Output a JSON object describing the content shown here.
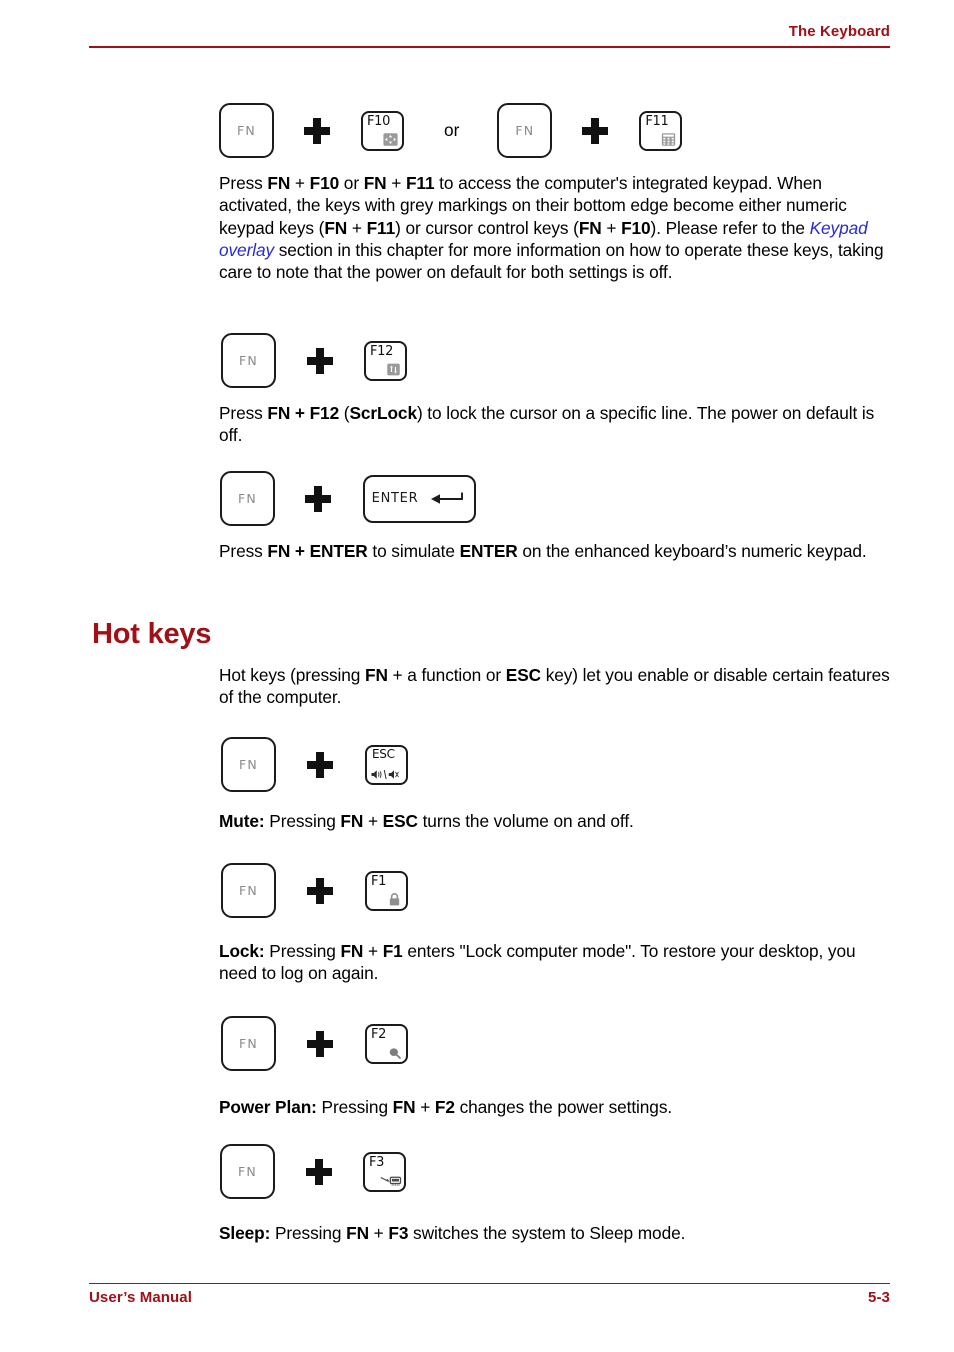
{
  "header": {
    "title": "The Keyboard"
  },
  "footer": {
    "manual_label": "User’s Manual",
    "page_number": "5-3"
  },
  "colors": {
    "accent_red": "#a11016",
    "link_blue": "#2a2ad0",
    "key_outline": "#1b1b1b",
    "fn_label_grey": "#8a8a8a"
  },
  "keys": {
    "fn_label": "FN",
    "enter_label": "ENTER",
    "or_label": "or",
    "f10_label": "F10",
    "f11_label": "F11",
    "f12_label": "F12",
    "esc_label": "ESC",
    "f1_label": "F1",
    "f2_label": "F2",
    "f3_label": "F3"
  },
  "sections": {
    "keypad": {
      "paragraph_parts": [
        {
          "t": "Press ",
          "s": "normal"
        },
        {
          "t": "FN",
          "s": "bold"
        },
        {
          "t": " + ",
          "s": "normal"
        },
        {
          "t": "F10",
          "s": "bold"
        },
        {
          "t": " or ",
          "s": "normal"
        },
        {
          "t": "FN",
          "s": "bold"
        },
        {
          "t": " + ",
          "s": "normal"
        },
        {
          "t": "F11",
          "s": "bold"
        },
        {
          "t": " to access the computer's integrated keypad. When activated, the keys with grey markings on their bottom edge become either numeric keypad keys (",
          "s": "normal"
        },
        {
          "t": "FN",
          "s": "bold"
        },
        {
          "t": " + ",
          "s": "normal"
        },
        {
          "t": "F11",
          "s": "bold"
        },
        {
          "t": ") or cursor control keys (",
          "s": "normal"
        },
        {
          "t": "FN",
          "s": "bold"
        },
        {
          "t": " + ",
          "s": "normal"
        },
        {
          "t": "F10",
          "s": "bold"
        },
        {
          "t": "). Please refer to the ",
          "s": "normal"
        },
        {
          "t": "Keypad overlay",
          "s": "link"
        },
        {
          "t": " section in this chapter for more information on how to operate these keys, taking care to note that the power on default for both settings is off.",
          "s": "normal"
        }
      ]
    },
    "scrlock": {
      "paragraph_parts": [
        {
          "t": "Press ",
          "s": "normal"
        },
        {
          "t": "FN + F12",
          "s": "bold"
        },
        {
          "t": " (",
          "s": "normal"
        },
        {
          "t": "ScrLock",
          "s": "bold"
        },
        {
          "t": ") to lock the cursor on a specific line. The power on default is off.",
          "s": "normal"
        }
      ]
    },
    "enter": {
      "paragraph_parts": [
        {
          "t": "Press ",
          "s": "normal"
        },
        {
          "t": "FN + ENTER",
          "s": "bold"
        },
        {
          "t": " to simulate ",
          "s": "normal"
        },
        {
          "t": "ENTER",
          "s": "bold"
        },
        {
          "t": " on the enhanced keyboard’s numeric keypad.",
          "s": "normal"
        }
      ]
    },
    "hotkeys": {
      "heading": "Hot keys",
      "intro_parts": [
        {
          "t": "Hot keys (pressing ",
          "s": "normal"
        },
        {
          "t": "FN",
          "s": "bold"
        },
        {
          "t": " + a function or ",
          "s": "normal"
        },
        {
          "t": "ESC",
          "s": "bold"
        },
        {
          "t": " key) let you enable or disable certain features of the computer.",
          "s": "normal"
        }
      ]
    },
    "mute": {
      "paragraph_parts": [
        {
          "t": "Mute:",
          "s": "bold"
        },
        {
          "t": " Pressing ",
          "s": "normal"
        },
        {
          "t": "FN",
          "s": "bold"
        },
        {
          "t": " + ",
          "s": "normal"
        },
        {
          "t": "ESC",
          "s": "bold"
        },
        {
          "t": " turns the volume on and off.",
          "s": "normal"
        }
      ]
    },
    "lock": {
      "paragraph_parts": [
        {
          "t": "Lock:",
          "s": "bold"
        },
        {
          "t": " Pressing ",
          "s": "normal"
        },
        {
          "t": "FN",
          "s": "bold"
        },
        {
          "t": " + ",
          "s": "normal"
        },
        {
          "t": "F1",
          "s": "bold"
        },
        {
          "t": " enters \"Lock computer mode\". To restore your desktop, you need to log on again.",
          "s": "normal"
        }
      ]
    },
    "powerplan": {
      "paragraph_parts": [
        {
          "t": "Power Plan:",
          "s": "bold"
        },
        {
          "t": " Pressing ",
          "s": "normal"
        },
        {
          "t": "FN",
          "s": "bold"
        },
        {
          "t": " + ",
          "s": "normal"
        },
        {
          "t": "F2",
          "s": "bold"
        },
        {
          "t": " changes the power settings.",
          "s": "normal"
        }
      ]
    },
    "sleep": {
      "paragraph_parts": [
        {
          "t": "Sleep:",
          "s": "bold"
        },
        {
          "t": " Pressing ",
          "s": "normal"
        },
        {
          "t": "FN",
          "s": "bold"
        },
        {
          "t": " + ",
          "s": "normal"
        },
        {
          "t": "F3",
          "s": "bold"
        },
        {
          "t": " switches the system to Sleep mode.",
          "s": "normal"
        }
      ]
    }
  },
  "icon_names": {
    "f10": "cursor-control-icon",
    "f11": "numeric-keypad-icon",
    "f12": "scroll-lock-icon",
    "esc": "mute-speaker-icon",
    "f1": "padlock-icon",
    "f2": "power-plan-icon",
    "f3": "sleep-icon",
    "enter": "return-arrow-icon"
  }
}
